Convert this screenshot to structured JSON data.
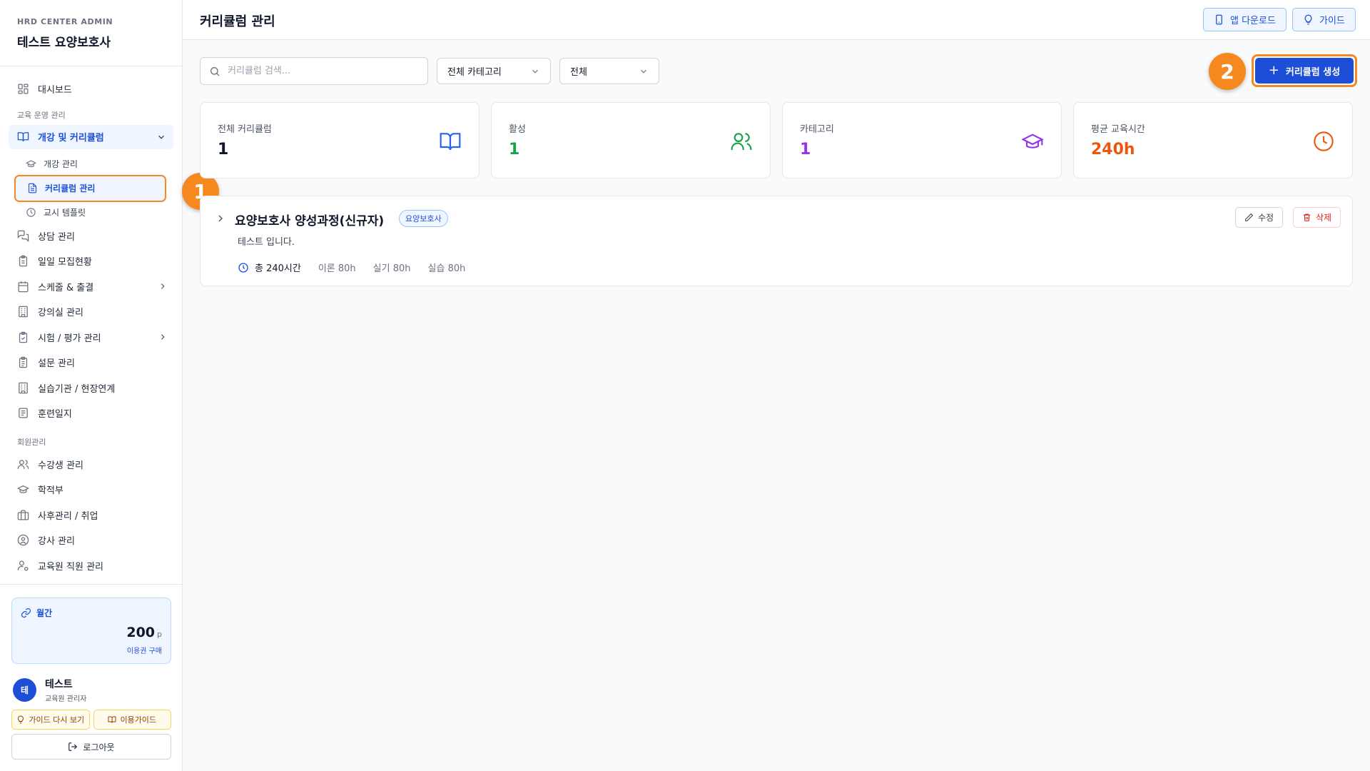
{
  "brand": {
    "subtitle": "HRD CENTER ADMIN",
    "title": "테스트 요양보호사"
  },
  "sidebar": {
    "dashboard": "대시보드",
    "section_edu": "교육 운영 관리",
    "group_curriculum": "개강 및 커리큘럼",
    "sub_items": [
      "개강 관리",
      "커리큘럼 관리",
      "교시 템플릿"
    ],
    "items_a": [
      "상담 관리",
      "일일 모집현황",
      "스케줄 & 출결",
      "강의실 관리",
      "시험 / 평가 관리",
      "설문 관리",
      "실습기관 / 현장연계",
      "훈련일지"
    ],
    "section_members": "회원관리",
    "items_b": [
      "수강생 관리",
      "학적부",
      "사후관리 / 취업",
      "강사 관리",
      "교육원 직원 관리"
    ]
  },
  "plan": {
    "label": "월간",
    "points": "200",
    "unit": "p",
    "buy": "이용권 구매"
  },
  "user": {
    "initial": "테",
    "name": "테스트",
    "role": "교육원 관리자"
  },
  "guide": {
    "replay": "가이드 다시 보기",
    "usage": "이용가이드",
    "logout": "로그아웃"
  },
  "header": {
    "title": "커리큘럼 관리",
    "app_download": "앱 다운로드",
    "guide": "가이드"
  },
  "filters": {
    "search_placeholder": "커리큘럼 검색...",
    "category": "전체 카테고리",
    "status": "전체"
  },
  "create_button": "커리큘럼 생성",
  "callouts": [
    "1",
    "2"
  ],
  "stats": [
    {
      "label": "전체 커리큘럼",
      "value": "1",
      "color": "#0f172a"
    },
    {
      "label": "활성",
      "value": "1",
      "color": "#16a34a"
    },
    {
      "label": "카테고리",
      "value": "1",
      "color": "#9333ea"
    },
    {
      "label": "평균 교육시간",
      "value": "240h",
      "color": "#ea580c"
    }
  ],
  "course": {
    "title": "요양보호사 양성과정(신규자)",
    "tag": "요양보호사",
    "description": "테스트 입니다.",
    "total": "총 240시간",
    "theory": "이론 80h",
    "practice": "실기 80h",
    "training": "실습 80h",
    "edit": "수정",
    "delete": "삭제"
  },
  "colors": {
    "accent": "#1d4ed8",
    "highlight": "#f5891f"
  }
}
